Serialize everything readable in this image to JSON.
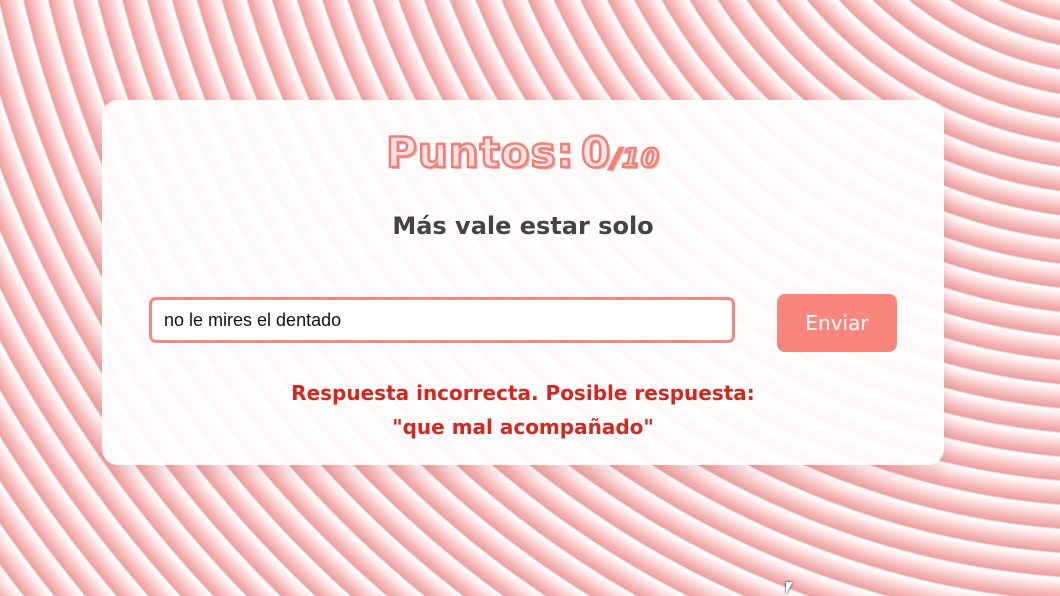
{
  "score": {
    "label": "Puntos:",
    "value": "0",
    "total": "/10"
  },
  "phrase": "Más vale estar solo",
  "answer": {
    "value": "no le mires el dentado"
  },
  "submit_label": "Enviar",
  "feedback": {
    "line1": "Respuesta incorrecta. Posible respuesta:",
    "line2": "\"que mal acompañado\""
  },
  "colors": {
    "accent": "#f8867c",
    "error": "#d3271f",
    "text": "#444444"
  }
}
